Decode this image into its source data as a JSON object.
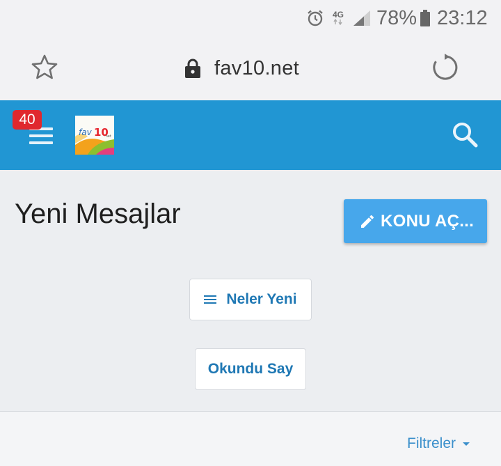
{
  "status_bar": {
    "network": "4G",
    "battery_percent": "78%",
    "time": "23:12",
    "icons": [
      "alarm-icon",
      "signal-icon",
      "battery-icon"
    ]
  },
  "browser": {
    "url": "fav10.net",
    "icons": [
      "star-icon",
      "lock-icon",
      "reload-icon"
    ]
  },
  "header": {
    "notification_count": "40",
    "logo_text": "fav10.net",
    "accent_color": "#2196d3",
    "icons": [
      "menu-icon",
      "search-icon"
    ]
  },
  "main": {
    "title": "Yeni Mesajlar",
    "new_thread_label": "KONU AÇ...",
    "whats_new_label": "Neler Yeni",
    "mark_read_label": "Okundu Say",
    "filters_label": "Filtreler",
    "button_color": "#47a7eb",
    "link_color": "#1f78b4"
  }
}
